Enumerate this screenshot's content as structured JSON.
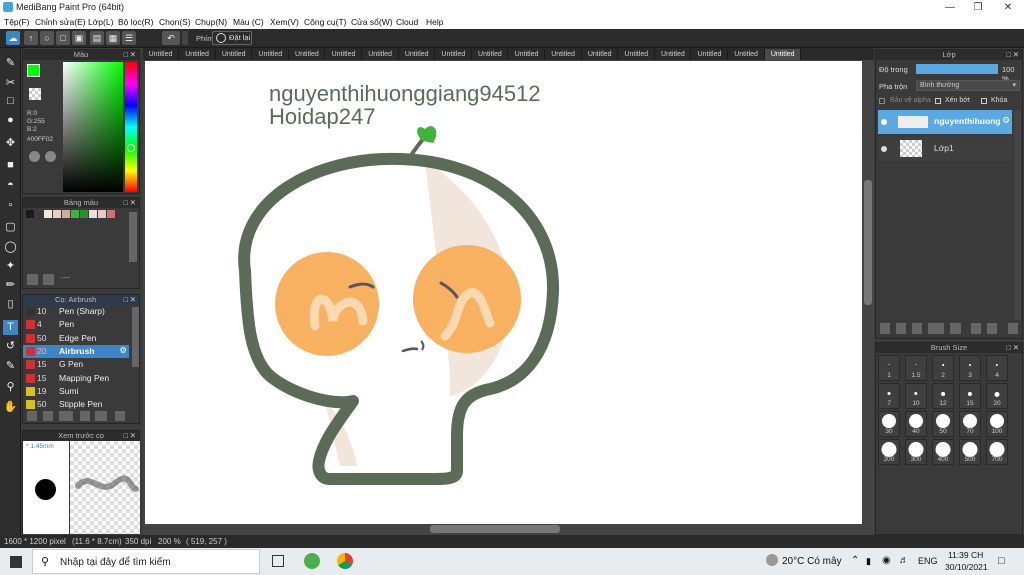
{
  "window": {
    "title": "MediBang Paint Pro (64bit)"
  },
  "menu": [
    "Tệp(F)",
    "Chỉnh sửa(E)",
    "Lớp(L)",
    "Bộ lọc(R)",
    "Chọn(S)",
    "Chụp(N)",
    "Màu (C)",
    "Xem(V)",
    "Công cụ(T)",
    "Cửa sổ(W)",
    "Cloud",
    "Help"
  ],
  "toolbar": {
    "phim_label": "Phím",
    "reset_label": "Đặt lại"
  },
  "tabs": [
    "Untitled",
    "Untitled",
    "Untitled",
    "Untitled",
    "Untitled",
    "Untitled",
    "Untitled",
    "Untitled",
    "Untitled",
    "Untitled",
    "Untitled",
    "Untitled",
    "Untitled",
    "Untitled",
    "Untitled",
    "Untitled",
    "Untitled",
    "Untitled"
  ],
  "color_panel": {
    "title": "Màu",
    "r": "R:0",
    "g": "G:255",
    "b": "B:2",
    "hex": "#00FF02",
    "fg_color": "#00ff02"
  },
  "palette_panel": {
    "title": "Bảng màu",
    "colors": [
      "#1a1a1a",
      "#3a3a3a",
      "#f4e6d8",
      "#e8d0c0",
      "#c8b0a0",
      "#3fb43c",
      "#2b8f2b",
      "#f0dcdc",
      "#e8c8c8",
      "#d07070"
    ],
    "dash": "----"
  },
  "brush_panel": {
    "title": "Cọ: Airbrush",
    "items": [
      {
        "size": "10",
        "name": "Pen (Sharp)",
        "color": "#333333"
      },
      {
        "size": "4",
        "name": "Pen",
        "color": "#cc3333"
      },
      {
        "size": "50",
        "name": "Edge Pen",
        "color": "#cc3333"
      },
      {
        "size": "20",
        "name": "Airbrush",
        "color": "#cc3333"
      },
      {
        "size": "15",
        "name": "G Pen",
        "color": "#cc3333"
      },
      {
        "size": "15",
        "name": "Mapping Pen",
        "color": "#cc3333"
      },
      {
        "size": "19",
        "name": "Sumi",
        "color": "#d8c020"
      },
      {
        "size": "50",
        "name": "Stipple Pen",
        "color": "#d8c020"
      }
    ]
  },
  "preview_panel": {
    "title": "Xem trước cọ",
    "size": "* 1.45mm"
  },
  "canvas": {
    "text1": "nguyenthihuonggiang94512",
    "text2": "Hoidap247"
  },
  "layer_panel": {
    "title": "Lớp",
    "opacity_label": "Độ trong",
    "opacity_value": "100 %",
    "opacity": 1.0,
    "blend_label": "Pha trộn",
    "blend_value": "Bình thường",
    "protect_alpha": "Bảo vệ alpha",
    "clipping": "Xén bớt",
    "lock": "Khóa",
    "layers": [
      {
        "name": "nguyenthihuong"
      },
      {
        "name": "Lớp1"
      }
    ]
  },
  "brushsize_panel": {
    "title": "Brush Size",
    "sizes": [
      "1",
      "1.5",
      "2",
      "3",
      "4",
      "7",
      "10",
      "12",
      "15",
      "20",
      "30",
      "40",
      "50",
      "70",
      "100",
      "200",
      "300",
      "400",
      "500",
      "700"
    ]
  },
  "status": {
    "dimensions": "1600 * 1200 pixel",
    "physical": "(11.6 * 8.7cm)",
    "dpi": "350 dpi",
    "zoom": "200 %",
    "coords": "( 519, 257 )"
  },
  "taskbar": {
    "search": "Nhập tại đây để tìm kiếm",
    "weather": "20°C Có mây",
    "lang": "ENG",
    "time": "11:39 CH",
    "date": "30/10/2021"
  }
}
